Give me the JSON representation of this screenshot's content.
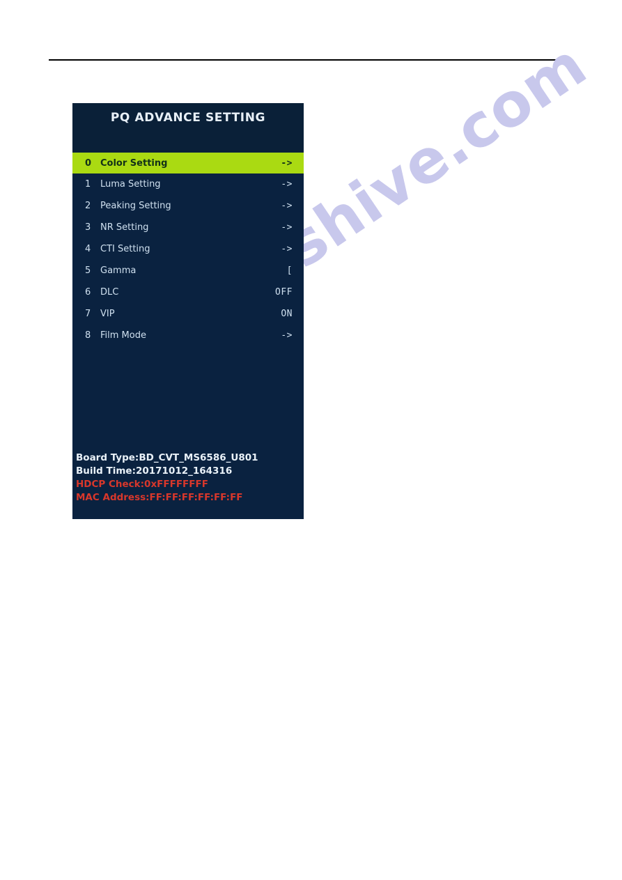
{
  "watermark": {
    "text": "manualshive.com"
  },
  "osd": {
    "title": "PQ ADVANCE SETTING",
    "colors": {
      "panel_bg": "#0a2240",
      "header_bg": "#0a2038",
      "highlight": "#aada12",
      "text": "#cfe0ef",
      "alert_text": "#d8372b"
    },
    "rows": [
      {
        "index": "0",
        "label": "Color Setting",
        "value": "->",
        "selected": true
      },
      {
        "index": "1",
        "label": "Luma Setting",
        "value": "->",
        "selected": false
      },
      {
        "index": "2",
        "label": "Peaking Setting",
        "value": "->",
        "selected": false
      },
      {
        "index": "3",
        "label": "NR Setting",
        "value": "->",
        "selected": false
      },
      {
        "index": "4",
        "label": "CTI Setting",
        "value": "->",
        "selected": false
      },
      {
        "index": "5",
        "label": "Gamma",
        "value": "[",
        "selected": false
      },
      {
        "index": "6",
        "label": "DLC",
        "value": "OFF",
        "selected": false
      },
      {
        "index": "7",
        "label": "VIP",
        "value": "ON",
        "selected": false
      },
      {
        "index": "8",
        "label": "Film Mode",
        "value": "->",
        "selected": false
      }
    ],
    "footer": [
      {
        "text": "Board Type:BD_CVT_MS6586_U801",
        "style": "info"
      },
      {
        "text": "Build Time:20171012_164316",
        "style": "info"
      },
      {
        "text": "HDCP Check:0xFFFFFFFF",
        "style": "alert"
      },
      {
        "text": "MAC Address:FF:FF:FF:FF:FF:FF",
        "style": "alert"
      }
    ]
  }
}
